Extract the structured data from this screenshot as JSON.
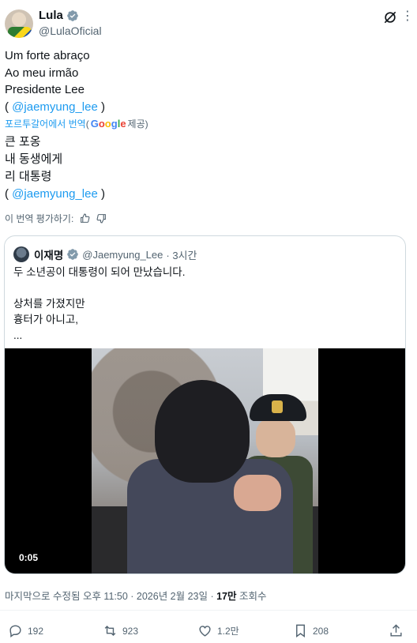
{
  "author": {
    "name": "Lula",
    "handle": "@LulaOficial"
  },
  "post": {
    "lines": [
      "Um forte abraço",
      "Ao meu irmão",
      "Presidente Lee"
    ],
    "mention_line": {
      "open": "( ",
      "mention": "@jaemyung_lee",
      "close": " )"
    }
  },
  "translation": {
    "label": "포르투갈어에서 번역",
    "paren_open": "(",
    "provider_letters": [
      "G",
      "o",
      "o",
      "g",
      "l",
      "e"
    ],
    "suffix": " 제공)",
    "lines": [
      "큰 포옹",
      "내 동생에게",
      "리 대통령"
    ],
    "mention_line": {
      "open": "( ",
      "mention": "@jaemyung_lee",
      "close": " )"
    },
    "rate_label": "이 번역 평가하기:"
  },
  "quote": {
    "name": "이재명",
    "handle": "@Jaemyung_Lee",
    "time": "· 3시간",
    "lines": [
      "두 소년공이 대통령이 되어 만났습니다.",
      "",
      "상처를 가졌지만",
      "흉터가 아니고,",
      "..."
    ],
    "video_time": "0:05"
  },
  "meta": {
    "edited": "마지막으로 수정됨 오후 11:50 · 2026년 2월 23일 · ",
    "views_count": "17만",
    "views_label": " 조회수"
  },
  "actions": {
    "replies": "192",
    "reposts": "923",
    "likes": "1.2만",
    "bookmarks": "208"
  },
  "colors": {
    "link": "#1d9bf0",
    "secondary_text": "#536471",
    "verified": "#829aab"
  }
}
